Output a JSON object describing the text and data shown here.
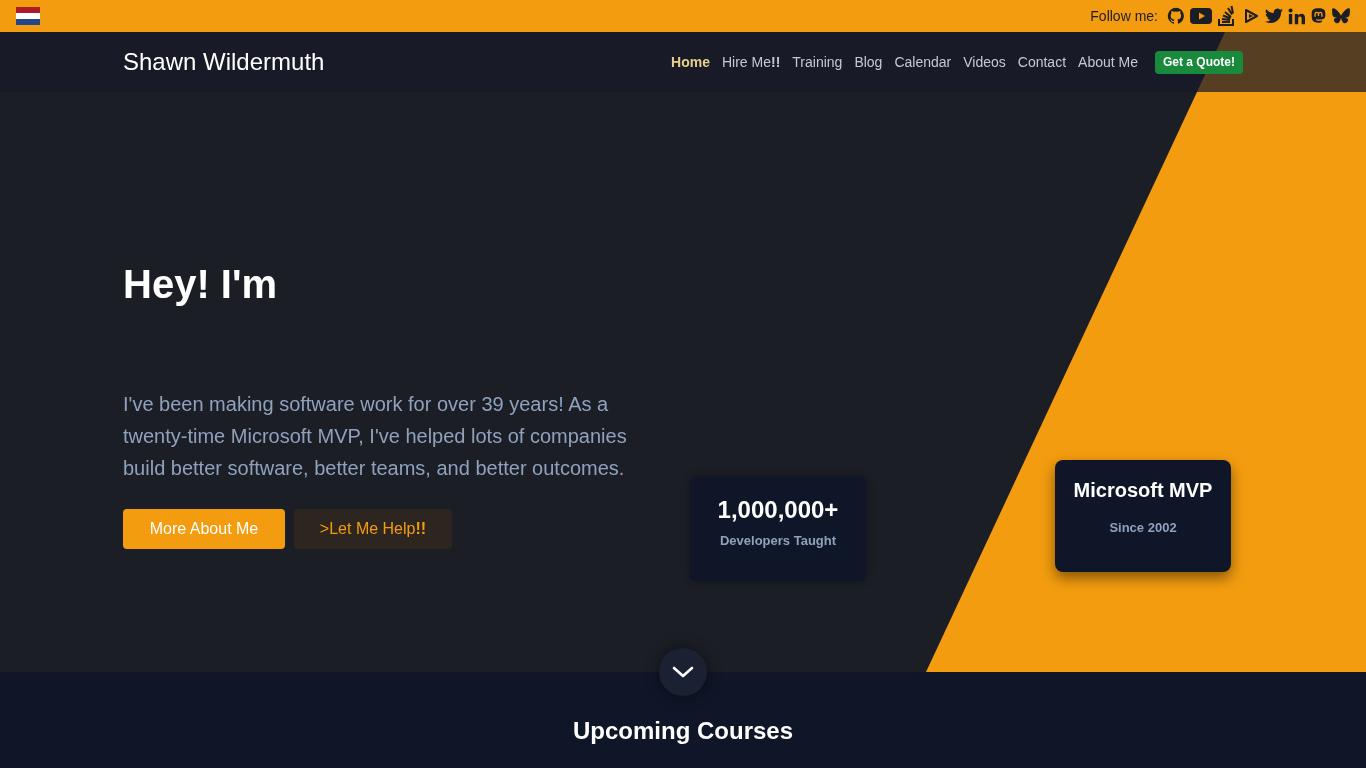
{
  "top_bar": {
    "follow_label": "Follow me:"
  },
  "nav": {
    "brand": "Shawn Wildermuth",
    "items": [
      {
        "label": "Home",
        "selected": true
      },
      {
        "label": "Hire Me**!!**",
        "selected": false
      },
      {
        "label": "Training",
        "selected": false
      },
      {
        "label": "Blog",
        "selected": false
      },
      {
        "label": "Calendar",
        "selected": false
      },
      {
        "label": "Videos",
        "selected": false
      },
      {
        "label": "Contact",
        "selected": false
      },
      {
        "label": "About Me",
        "selected": false
      }
    ],
    "cta": "Get a Quote!"
  },
  "hero": {
    "heading": "Hey! I'm",
    "text": "I've been making software work for over 39 years! As a twenty-time Microsoft MVP, I've helped lots of companies build better software, better teams, and better outcomes.",
    "buttons": [
      {
        "label": "More About Me",
        "kind": "primary"
      },
      {
        "label": ">Let Me Help**!!**",
        "kind": "secondary"
      }
    ],
    "stats": [
      {
        "value": "1,000,000+",
        "label": "Developers Taught"
      },
      {
        "value": "Microsoft MVP",
        "label": "Since 2002"
      }
    ]
  },
  "section": {
    "heading": "Upcoming Courses"
  }
}
